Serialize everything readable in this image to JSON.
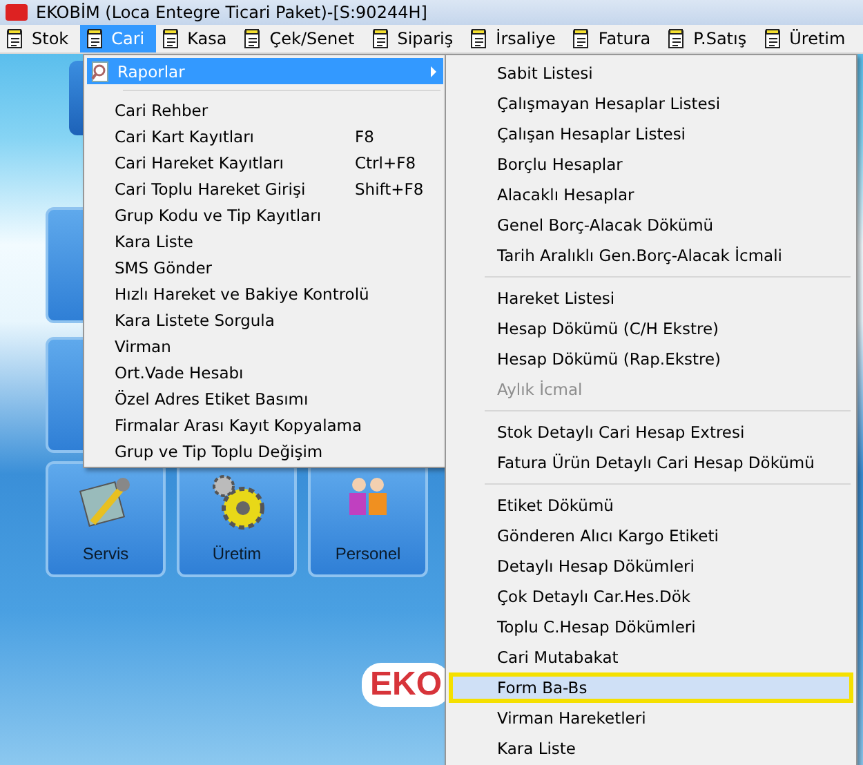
{
  "window": {
    "title": "EKOBİM (Loca Entegre Ticari Paket)-[S:90244H]"
  },
  "menubar": [
    {
      "label": "Stok",
      "selected": false
    },
    {
      "label": "Cari",
      "selected": true
    },
    {
      "label": "Kasa",
      "selected": false
    },
    {
      "label": "Çek/Senet",
      "selected": false
    },
    {
      "label": "Sipariş",
      "selected": false
    },
    {
      "label": "İrsaliye",
      "selected": false
    },
    {
      "label": "Fatura",
      "selected": false
    },
    {
      "label": "P.Satış",
      "selected": false
    },
    {
      "label": "Üretim",
      "selected": false
    }
  ],
  "desktop": {
    "tiles": [
      {
        "label": "Servis",
        "kind": "service"
      },
      {
        "label": "Üretim",
        "kind": "gears"
      },
      {
        "label": "Personel",
        "kind": "people"
      }
    ],
    "logo_text": "EKO"
  },
  "cari_menu": {
    "groups": [
      [
        {
          "label": "Raporlar",
          "selected": true,
          "submenu": true
        }
      ],
      [
        {
          "label": "Cari Rehber",
          "selected": false
        },
        {
          "label": "Cari Kart Kayıtları",
          "shortcut": "F8",
          "selected": false
        },
        {
          "label": "Cari Hareket Kayıtları",
          "shortcut": "Ctrl+F8",
          "selected": false
        },
        {
          "label": "Cari Toplu Hareket Girişi",
          "shortcut": "Shift+F8",
          "selected": false
        },
        {
          "label": "Grup Kodu ve Tip Kayıtları",
          "selected": false
        },
        {
          "label": "Kara Liste",
          "selected": false
        },
        {
          "label": "SMS Gönder",
          "selected": false
        },
        {
          "label": "Hızlı Hareket ve Bakiye Kontrolü",
          "selected": false
        },
        {
          "label": "Kara Listete Sorgula",
          "selected": false
        },
        {
          "label": "Virman",
          "selected": false
        },
        {
          "label": "Ort.Vade Hesabı",
          "selected": false
        },
        {
          "label": "Özel Adres Etiket Basımı",
          "selected": false
        },
        {
          "label": "Firmalar Arası Kayıt Kopyalama",
          "selected": false
        },
        {
          "label": "Grup ve Tip Toplu Değişim",
          "selected": false
        }
      ]
    ]
  },
  "raporlar_menu": {
    "groups": [
      [
        {
          "label": "Sabit Listesi",
          "selected": false,
          "disabled": false,
          "annotated": false
        },
        {
          "label": "Çalışmayan Hesaplar Listesi",
          "selected": false,
          "disabled": false,
          "annotated": false
        },
        {
          "label": "Çalışan Hesaplar Listesi",
          "selected": false,
          "disabled": false,
          "annotated": false
        },
        {
          "label": "Borçlu Hesaplar",
          "selected": false,
          "disabled": false,
          "annotated": false
        },
        {
          "label": "Alacaklı Hesaplar",
          "selected": false,
          "disabled": false,
          "annotated": false
        },
        {
          "label": "Genel Borç-Alacak Dökümü",
          "selected": false,
          "disabled": false,
          "annotated": false
        },
        {
          "label": "Tarih Aralıklı Gen.Borç-Alacak İcmali",
          "selected": false,
          "disabled": false,
          "annotated": false
        }
      ],
      [
        {
          "label": "Hareket Listesi",
          "selected": false,
          "disabled": false,
          "annotated": false
        },
        {
          "label": "Hesap Dökümü (C/H Ekstre)",
          "selected": false,
          "disabled": false,
          "annotated": false
        },
        {
          "label": "Hesap Dökümü (Rap.Ekstre)",
          "selected": false,
          "disabled": false,
          "annotated": false
        },
        {
          "label": "Aylık İcmal",
          "selected": false,
          "disabled": true,
          "annotated": false
        }
      ],
      [
        {
          "label": "Stok Detaylı Cari Hesap Extresi",
          "selected": false,
          "disabled": false,
          "annotated": false
        },
        {
          "label": "Fatura Ürün Detaylı Cari Hesap Dökümü",
          "selected": false,
          "disabled": false,
          "annotated": false
        }
      ],
      [
        {
          "label": "Etiket Dökümü",
          "selected": false,
          "disabled": false,
          "annotated": false
        },
        {
          "label": "Gönderen Alıcı Kargo Etiketi",
          "selected": false,
          "disabled": false,
          "annotated": false
        },
        {
          "label": "Detaylı Hesap Dökümleri",
          "selected": false,
          "disabled": false,
          "annotated": false
        },
        {
          "label": "Çok Detaylı Car.Hes.Dök",
          "selected": false,
          "disabled": false,
          "annotated": false
        },
        {
          "label": "Toplu C.Hesap Dökümleri",
          "selected": false,
          "disabled": false,
          "annotated": false
        },
        {
          "label": "Cari Mutabakat",
          "selected": false,
          "disabled": false,
          "annotated": false
        },
        {
          "label": "Form Ba-Bs",
          "selected": true,
          "disabled": false,
          "annotated": true
        },
        {
          "label": "Virman Hareketleri",
          "selected": false,
          "disabled": false,
          "annotated": false
        },
        {
          "label": "Kara Liste",
          "selected": false,
          "disabled": false,
          "annotated": false
        }
      ]
    ]
  }
}
